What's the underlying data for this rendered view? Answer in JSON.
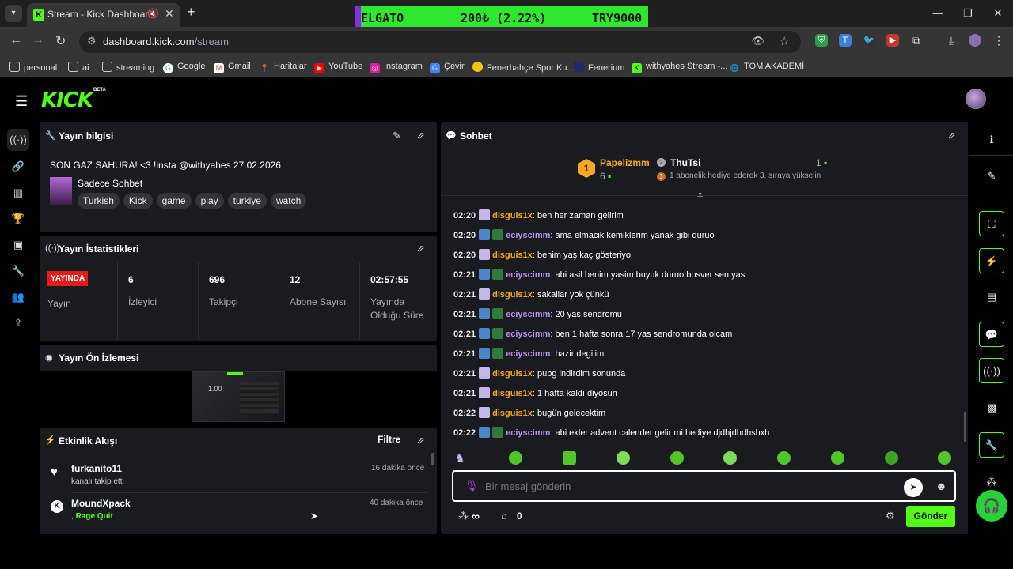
{
  "browser": {
    "tab_title": "Stream - Kick Dashboard",
    "url_host": "dashboard.kick.com",
    "url_path": "/stream",
    "ticker": {
      "name": "ELGATO",
      "change": "200₺ (2.22%)",
      "price": "TRY9000"
    },
    "bookmarks": [
      "personal",
      "ai",
      "streaming",
      "Google",
      "Gmail",
      "Haritalar",
      "YouTube",
      "Instagram",
      "Çevir",
      "Fenerbahçe Spor Ku...",
      "Fenerium",
      "withyahes Stream -...",
      "TOM AKADEMİ"
    ]
  },
  "brand": {
    "logo": "KICK",
    "beta": "BETA",
    "accent": "#53fc18"
  },
  "stream_info": {
    "title": "Yayın bilgisi",
    "stream_title": "SON GAZ SAHURA! <3 !insta @withyahes 27.02.2026",
    "category": "Sadece Sohbet",
    "tags": [
      "Turkish",
      "Kick",
      "game",
      "play",
      "turkiye",
      "watch"
    ]
  },
  "stats": {
    "title": "Yayın İstatistikleri",
    "live_badge": "YAYINDA",
    "live_label": "Yayın",
    "items": [
      {
        "value": "6",
        "label": "İzleyici"
      },
      {
        "value": "696",
        "label": "Takipçi"
      },
      {
        "value": "12",
        "label": "Abone Sayısı"
      },
      {
        "value": "02:57:55",
        "label": "Yayında Olduğu Süre"
      }
    ]
  },
  "preview": {
    "title": "Yayın Ön İzlemesi",
    "overlay_text": "1.00"
  },
  "activity": {
    "title": "Etkinlik Akışı",
    "filter": "Filtre",
    "items": [
      {
        "user": "furkanito11",
        "detail": "kanalı takip etti",
        "time": "16 dakika önce"
      },
      {
        "user": "MoundXpack",
        "prefix": ",",
        "detail": "Rage Quit",
        "time": "40 dakika önce"
      }
    ]
  },
  "chat": {
    "title": "Sohbet",
    "leaderboard": {
      "rank1_name": "Papelizmm",
      "rank1_count": "6",
      "rank2_name": "ThuTsi",
      "rank2_count": "1",
      "rank3_text": "1 abonelik hediye ederek 3. sıraya yükselin",
      "rank1_badge": "1",
      "rank2_badge": "2",
      "rank3_badge": "3"
    },
    "messages": [
      {
        "time": "02:20",
        "user": "disguis1x",
        "text": ": ben her zaman gelirim"
      },
      {
        "time": "02:20",
        "user": "eciyscimm",
        "text": ": ama elmacik kemiklerim yanak gibi duruo"
      },
      {
        "time": "02:20",
        "user": "disguis1x",
        "text": ": benim yaş kaç gösteriyo"
      },
      {
        "time": "02:21",
        "user": "eciyscimm",
        "text": ": abi asil benim yasim buyuk duruo bosver sen yasi"
      },
      {
        "time": "02:21",
        "user": "disguis1x",
        "text": ": sakallar yok çünkü"
      },
      {
        "time": "02:21",
        "user": "eciyscimm",
        "text": ": 20 yas sendromu"
      },
      {
        "time": "02:21",
        "user": "eciyscimm",
        "text": ": ben 1 hafta sonra 17 yas sendromunda olcam"
      },
      {
        "time": "02:21",
        "user": "eciyscimm",
        "text": ": hazir degilim"
      },
      {
        "time": "02:21",
        "user": "disguis1x",
        "text": ": pubg indirdim sonunda"
      },
      {
        "time": "02:21",
        "user": "disguis1x",
        "text": ": 1 hafta kaldı diyosun"
      },
      {
        "time": "02:22",
        "user": "disguis1x",
        "text": ": bugün gelecektim"
      },
      {
        "time": "02:22",
        "user": "eciyscimm",
        "text": ": abi ekler advent calender gelir mi hediye djdhjdhdhshxh"
      }
    ],
    "input_placeholder": "Bir mesaj gönderin",
    "points": "∞",
    "store_count": "0",
    "send_label": "Gönder"
  }
}
